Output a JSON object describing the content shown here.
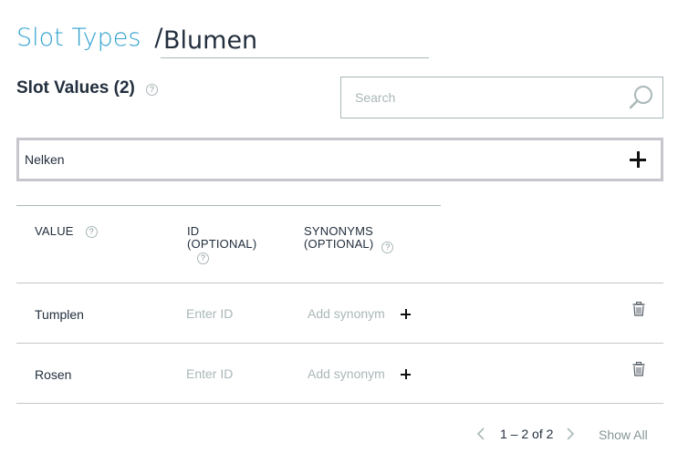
{
  "breadcrumb": {
    "parent_label": "Slot Types",
    "separator": "/",
    "current_name": "Blumen"
  },
  "slot_values": {
    "title": "Slot Values (2)",
    "help_glyph": "?"
  },
  "search": {
    "placeholder": "Search",
    "icon": "search-icon"
  },
  "new_value": {
    "value": "Nelken",
    "icon": "plus-icon"
  },
  "table": {
    "columns": [
      {
        "label": "VALUE"
      },
      {
        "label_line1": "ID",
        "label_line2": "(OPTIONAL)"
      },
      {
        "label_line1": "SYNONYMS",
        "label_line2": "(OPTIONAL)"
      }
    ],
    "rows": [
      {
        "value": "Tumplen",
        "id_placeholder": "Enter ID",
        "synonym_placeholder": "Add synonym"
      },
      {
        "value": "Rosen",
        "id_placeholder": "Enter ID",
        "synonym_placeholder": "Add synonym"
      }
    ]
  },
  "pagination": {
    "range": "1 – 2 of 2",
    "show_all": "Show All"
  },
  "colors": {
    "link": "#31a2d0",
    "text": "#232f3e",
    "muted": "#aab7b8"
  }
}
